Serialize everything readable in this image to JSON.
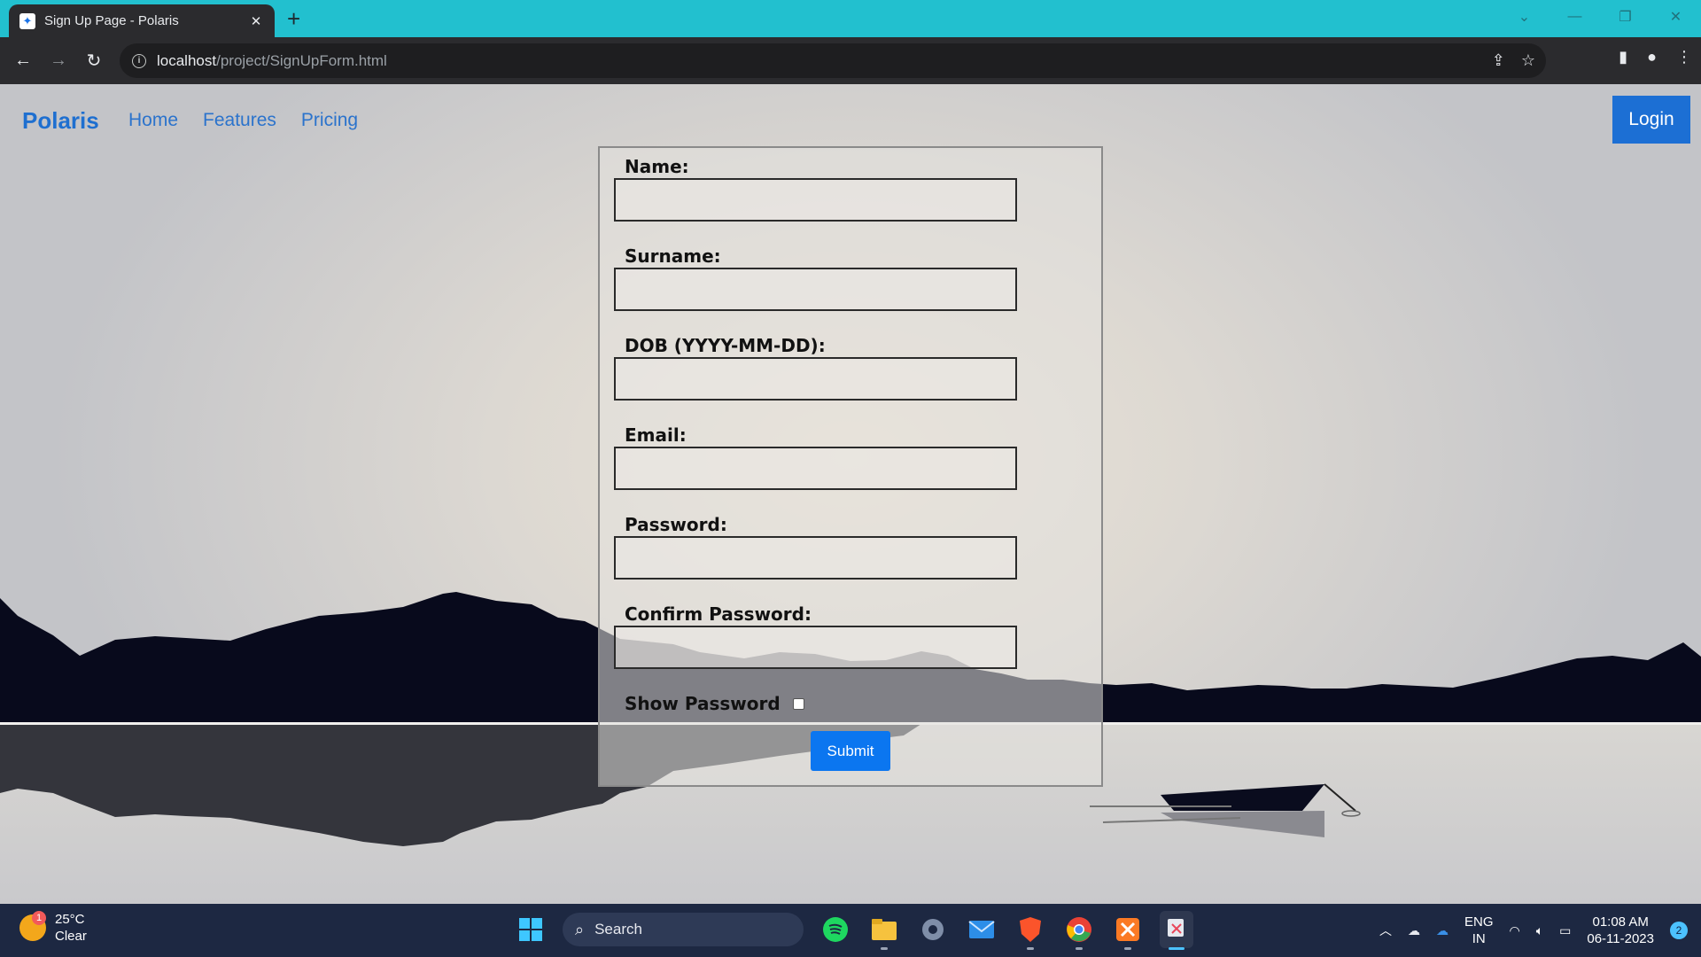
{
  "browser": {
    "tab_title": "Sign Up Page - Polaris",
    "tab_close": "✕",
    "new_tab": "+",
    "url_host": "localhost",
    "url_path": "/project/SignUpForm.html"
  },
  "site": {
    "brand": "Polaris",
    "nav_links": [
      "Home",
      "Features",
      "Pricing"
    ],
    "login_label": "Login"
  },
  "form": {
    "name_label": "Name:",
    "surname_label": "Surname:",
    "dob_label": "DOB (YYYY-MM-DD):",
    "email_label": "Email:",
    "password_label": "Password:",
    "confirm_label": "Confirm Password:",
    "show_password_label": "Show Password",
    "submit_label": "Submit"
  },
  "taskbar": {
    "weather_temp": "25°C",
    "weather_cond": "Clear",
    "weather_badge": "1",
    "search_label": "Search",
    "lang_line1": "ENG",
    "lang_line2": "IN",
    "time": "01:08 AM",
    "date": "06-11-2023",
    "notifications": "2"
  },
  "colors": {
    "tabstrip": "#22c0cf",
    "brand": "#1e6fd0",
    "login_button": "#1c6fd4",
    "submit_button": "#0b76f0",
    "taskbar": "#1d2842"
  }
}
